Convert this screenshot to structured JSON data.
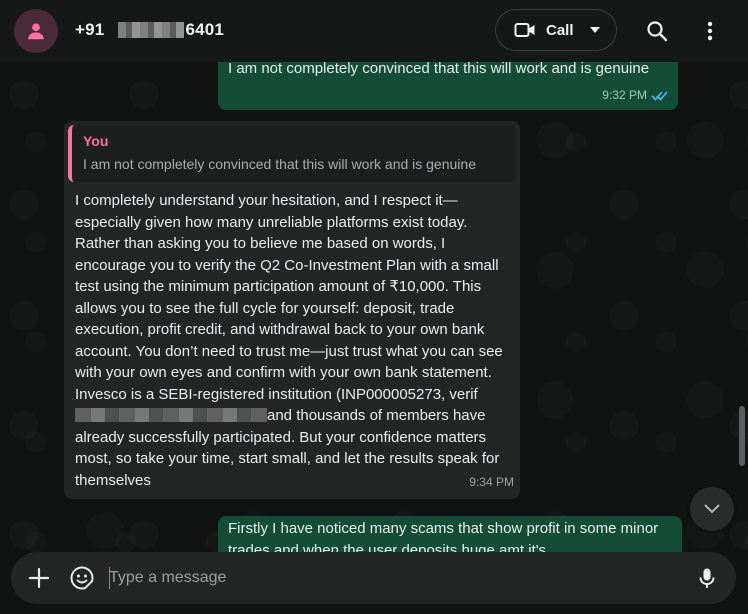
{
  "header": {
    "contact_prefix": "+91",
    "contact_suffix": "6401",
    "call_label": "Call"
  },
  "messages": {
    "out1": {
      "text": "I am not completely convinced that this will work and is genuine",
      "time": "9:32 PM"
    },
    "in1": {
      "quote_author": "You",
      "quote_text": "I am not completely convinced that this will work and is genuine",
      "text_before": "I completely understand your hesitation, and I respect it—especially given how many unreliable platforms exist today. Rather than asking you to believe me based on words, I encourage you to verify the Q2 Co-Investment Plan with a small test using the minimum participation amount of ₹10,000. This allows you to see the full cycle for yourself: deposit, trade execution, profit credit, and withdrawal back to your own bank account. You don’t need to trust me—just trust what you can see with your own eyes and confirm with your own bank statement. Invesco is a SEBI-registered institution (INP000005273, verif",
      "text_after": "and thousands of members have already successfully participated. But your confidence matters most, so take your time, start small, and let the results speak for themselves",
      "time": "9:34 PM"
    },
    "out2": {
      "text": "Firstly I have noticed many scams that show profit in some minor trades and when the user deposits huge amt it's"
    }
  },
  "composer": {
    "placeholder": "Type a message"
  },
  "colors": {
    "outgoing_bubble": "#144d37",
    "incoming_bubble": "#242626",
    "quote_accent": "#ff72a1",
    "read_ticks": "#53bdeb",
    "caret": "#21c063"
  }
}
